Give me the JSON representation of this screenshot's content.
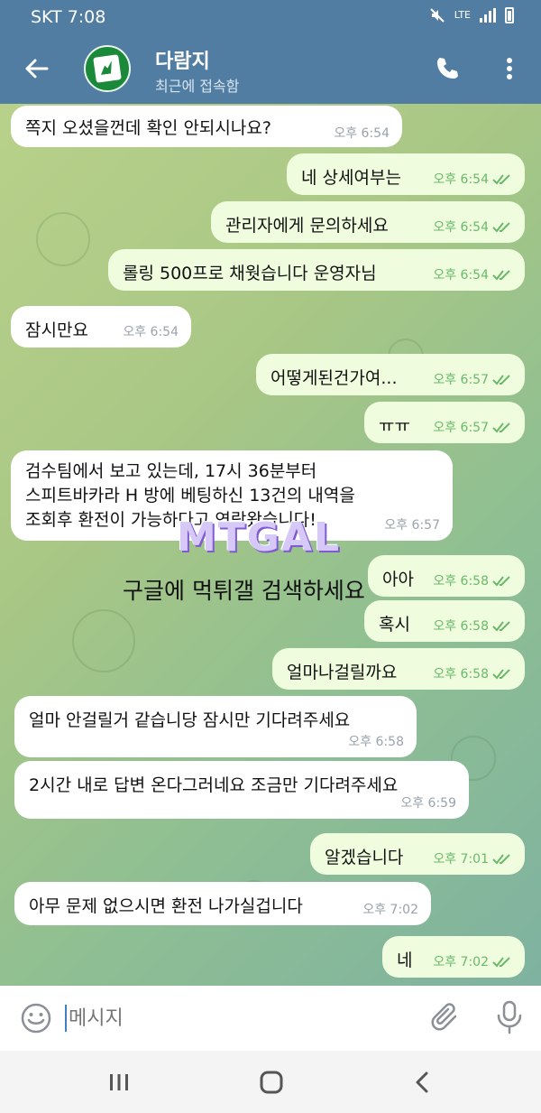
{
  "status_bar": {
    "carrier_time": "SKT 7:08",
    "network": "LTE"
  },
  "header": {
    "title": "다람지",
    "subtitle": "최근에 접속함"
  },
  "messages": [
    {
      "dir": "in",
      "text": "쪽지 오셨을껀데 확인 안되시나요?",
      "time": "오후 6:54"
    },
    {
      "dir": "out",
      "text": "네 상세여부는",
      "time": "오후 6:54"
    },
    {
      "dir": "out",
      "text": "관리자에게 문의하세요",
      "time": "오후 6:54"
    },
    {
      "dir": "out",
      "text": "롤링 500프로 채웟습니다 운영자님",
      "time": "오후 6:54"
    },
    {
      "dir": "in",
      "text": "잠시만요",
      "time": "오후 6:54"
    },
    {
      "dir": "out",
      "text": "어떻게된건가여...",
      "time": "오후 6:57"
    },
    {
      "dir": "out",
      "text": "ㅠㅠ",
      "time": "오후 6:57"
    },
    {
      "dir": "in",
      "lines": [
        "검수팀에서 보고 있는데, 17시 36분부터",
        "스피트바카라 H 방에 베팅하신 13건의 내역을",
        "조회후 환전이 가능하다고 연락왔습니다!"
      ],
      "time": "오후 6:57"
    },
    {
      "dir": "out",
      "text": "아아",
      "time": "오후 6:58"
    },
    {
      "dir": "out",
      "text": "혹시",
      "time": "오후 6:58"
    },
    {
      "dir": "out",
      "text": "얼마나걸릴까요",
      "time": "오후 6:58"
    },
    {
      "dir": "in",
      "text": "얼마 안걸릴거 같습니당 잠시만 기다려주세요",
      "time": "오후 6:58"
    },
    {
      "dir": "in",
      "text": "2시간 내로 답변 온다그러네요 조금만 기다려주세요",
      "time": "오후 6:59"
    },
    {
      "dir": "out",
      "text": "알겠습니다",
      "time": "오후 7:01"
    },
    {
      "dir": "in",
      "text": "아무 문제 없으시면 환전 나가실겁니다",
      "time": "오후 7:02"
    },
    {
      "dir": "out",
      "text": "네",
      "time": "오후 7:02"
    }
  ],
  "watermark": {
    "logo": "MTGAL",
    "caption": "구글에 먹튀갤 검색하세요"
  },
  "input": {
    "placeholder": "메시지"
  },
  "colors": {
    "header": "#517DA2",
    "incoming_bubble": "#ffffff",
    "outgoing_bubble": "#effdde",
    "check": "#6ab96a"
  },
  "icons": [
    "back-arrow-icon",
    "phone-icon",
    "more-vert-icon",
    "smile-icon",
    "attach-icon",
    "mic-icon",
    "nav-recent-icon",
    "nav-home-icon",
    "nav-back-icon"
  ]
}
